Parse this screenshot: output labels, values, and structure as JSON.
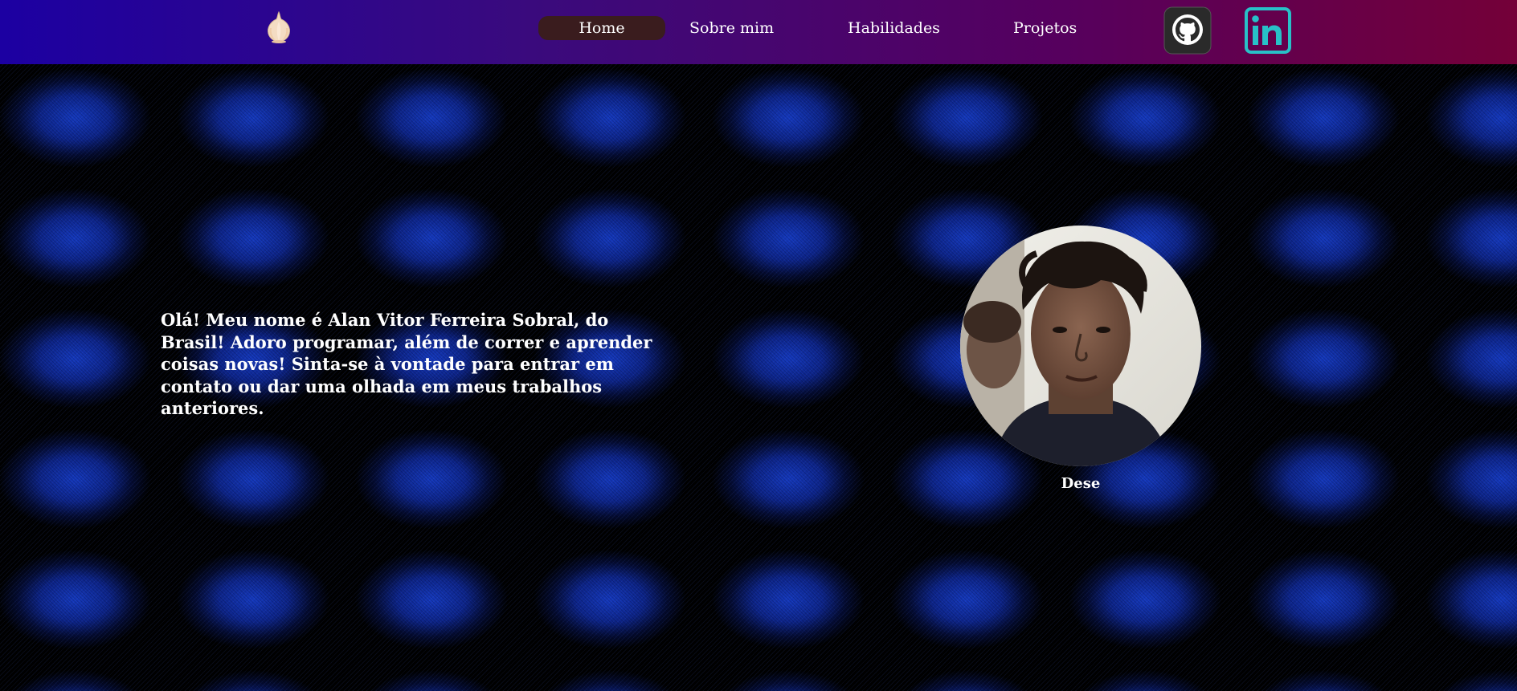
{
  "header": {
    "logo_icon": "garlic-icon",
    "nav": [
      {
        "label": "Home",
        "active": true
      },
      {
        "label": "Sobre mim",
        "active": false
      },
      {
        "label": "Habilidades",
        "active": false
      },
      {
        "label": "Projetos",
        "active": false
      }
    ],
    "social": [
      {
        "icon": "github-icon"
      },
      {
        "icon": "linkedin-icon"
      }
    ],
    "colors": {
      "gradient_start": "#1c00a2",
      "gradient_end": "#740038",
      "active_tab": "#3a1c1e"
    }
  },
  "main": {
    "intro_text": "Olá! Meu nome é Alan Vitor Ferreira Sobral, do Brasil! Adoro programar, além de correr e aprender coisas novas! Sinta-se à vontade para entrar em contato ou dar uma olhada em meus trabalhos anteriores.",
    "photo_caption": "Dese"
  }
}
